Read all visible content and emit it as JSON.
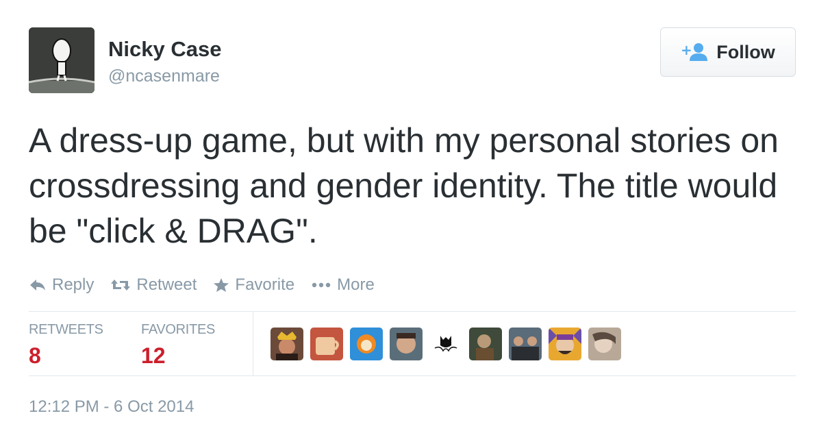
{
  "user": {
    "name": "Nicky Case",
    "handle": "@ncasenmare"
  },
  "follow_button": {
    "label": "Follow",
    "icon": "add-user-icon",
    "icon_color": "#55acee"
  },
  "tweet": {
    "text": "A dress-up game, but with my personal stories on crossdressing and gender identity. The title would be \"click & DRAG\".",
    "timestamp": "12:12 PM - 6 Oct 2014"
  },
  "actions": [
    {
      "label": "Reply",
      "icon": "reply-icon"
    },
    {
      "label": "Retweet",
      "icon": "retweet-icon"
    },
    {
      "label": "Favorite",
      "icon": "star-icon"
    },
    {
      "label": "More",
      "icon": "more-dots-icon"
    }
  ],
  "stats": {
    "retweets_label": "RETWEETS",
    "retweets_count": "8",
    "favorites_label": "FAVORITES",
    "favorites_count": "12"
  },
  "colors": {
    "text": "#292f33",
    "muted": "#8899a6",
    "count": "#cc1f2c",
    "accent": "#55acee",
    "divider": "#e1e8ed"
  },
  "favorited_by_avatars": [
    "user-avatar-1",
    "user-avatar-2",
    "user-avatar-3",
    "user-avatar-4",
    "user-avatar-5",
    "user-avatar-6",
    "user-avatar-7",
    "user-avatar-8",
    "user-avatar-9"
  ]
}
